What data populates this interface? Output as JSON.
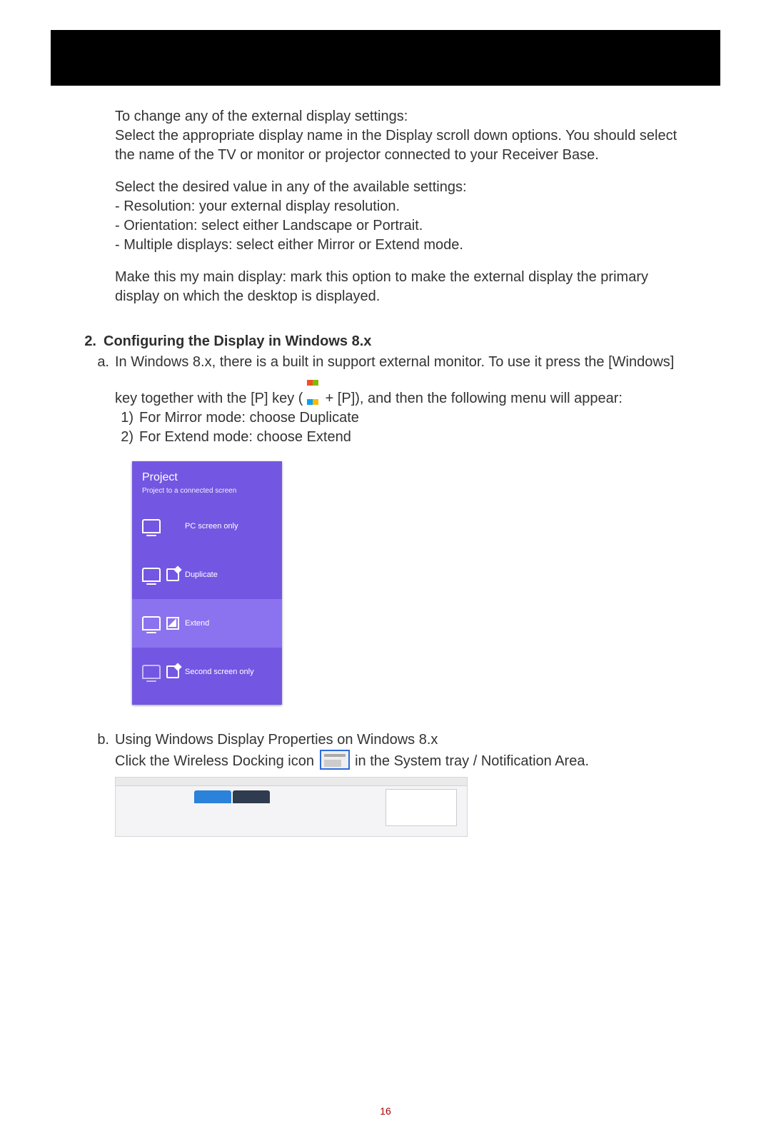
{
  "intro": {
    "p1": "To change any of the external display settings:",
    "p2": "Select the appropriate display name in the Display scroll down options. You should select the name of the TV or monitor or projector connected to your Receiver Base.",
    "p3": "Select the desired value in any of the available settings:",
    "b1": "- Resolution: your external display resolution.",
    "b2": "- Orientation: select either Landscape or Portrait.",
    "b3": "- Multiple displays: select either Mirror or Extend mode.",
    "p4": "Make this my main display: mark this option to make the external display the primary display on which the desktop is displayed."
  },
  "section2": {
    "number": "2.",
    "title": "Configuring the Display in Windows 8.x",
    "a": {
      "letter": "a.",
      "line1_pre": "In Windows 8.x, there is a built in support external monitor. To use it press the [Windows] key together with the [P] key ( ",
      "line1_post": " + [P]), and then the following menu will appear:",
      "mode1_num": "1)",
      "mode1_text": "For Mirror mode: choose Duplicate",
      "mode2_num": "2)",
      "mode2_text": "For Extend mode: choose Extend"
    },
    "panel": {
      "title": "Project",
      "subtitle": "Project to a connected screen",
      "opt1": "PC screen only",
      "opt2": "Duplicate",
      "opt3": "Extend",
      "opt4": "Second screen only"
    },
    "b": {
      "letter": "b.",
      "line1": "Using Windows Display Properties on Windows 8.x",
      "line2_pre": "Click the Wireless Docking icon ",
      "line2_post": " in the System tray / Notification Area."
    }
  },
  "page_number": "16"
}
